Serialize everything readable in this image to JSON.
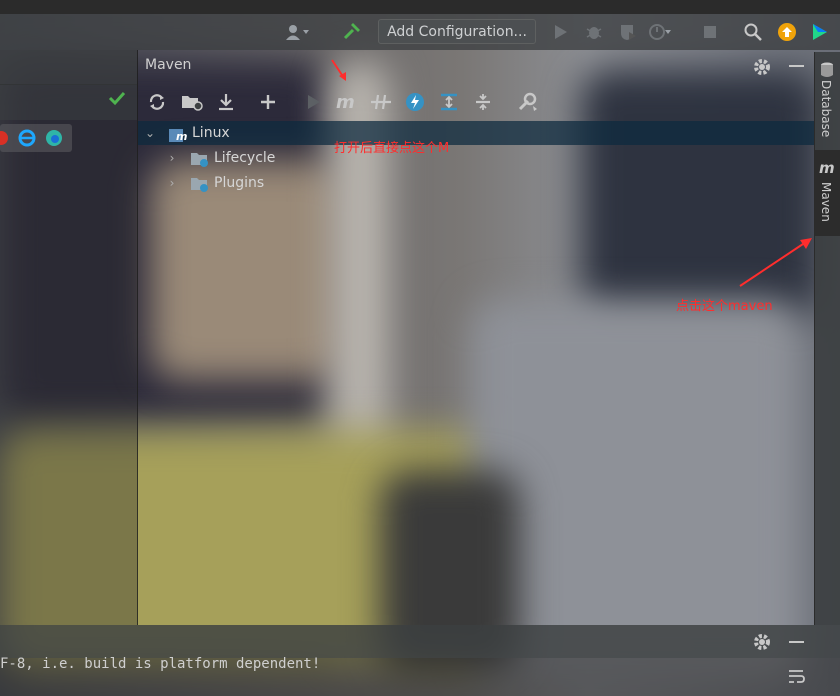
{
  "toolbar": {
    "config_label": "Add Configuration...",
    "icons": [
      "user-icon",
      "hammer-icon",
      "run-icon",
      "debug-icon",
      "coverage-icon",
      "profile-icon",
      "stop-icon",
      "search-icon",
      "update-icon",
      "plugin-icon"
    ]
  },
  "maven_panel": {
    "title": "Maven",
    "toolbar_icons": [
      "reload-icon",
      "add-folder-icon",
      "download-icon",
      "plus-icon",
      "run-icon",
      "maven-m-icon",
      "toggle-offline-icon",
      "lightning-icon",
      "expand-icon",
      "collapse-icon",
      "wrench-icon"
    ],
    "tree": {
      "root": "Linux",
      "children": [
        "Lifecycle",
        "Plugins"
      ]
    }
  },
  "right_stripe": {
    "tabs": [
      "Database",
      "Maven"
    ]
  },
  "console": {
    "line": "F-8, i.e. build is platform dependent!"
  },
  "annotations": {
    "top": "打开后直接点这个M",
    "right": "点击这个maven"
  },
  "colors": {
    "annotation": "#ff2d2d",
    "selection": "#0d293e",
    "check": "#4fb34f"
  }
}
